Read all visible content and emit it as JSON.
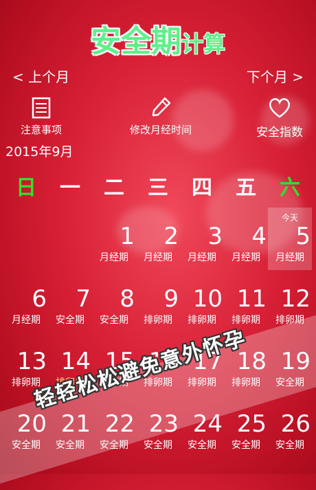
{
  "colors": {
    "title_green": "#5ff08a",
    "sunday": "#30e030",
    "saturday": "#30e030",
    "ovulation_label": "#ffe07a"
  },
  "title": {
    "main": "安全期",
    "sub": "计算"
  },
  "nav": {
    "prev": "< 上个月",
    "next": "下个月 >"
  },
  "tools": [
    {
      "label": "注意事项",
      "icon": "note-icon"
    },
    {
      "label": "修改月经时间",
      "icon": "pencil-icon"
    },
    {
      "label": "安全指数",
      "icon": "heart-icon"
    }
  ],
  "month_label": "2015年9月",
  "weekdays": [
    "日",
    "一",
    "二",
    "三",
    "四",
    "五",
    "六"
  ],
  "today_tag": "今天",
  "weeks": [
    [
      {
        "d": "",
        "l": ""
      },
      {
        "d": "",
        "l": ""
      },
      {
        "d": "1",
        "l": "月经期"
      },
      {
        "d": "2",
        "l": "月经期"
      },
      {
        "d": "3",
        "l": "月经期"
      },
      {
        "d": "4",
        "l": "月经期"
      },
      {
        "d": "5",
        "l": "月经期",
        "today": true
      }
    ],
    [
      {
        "d": "6",
        "l": "月经期"
      },
      {
        "d": "7",
        "l": "安全期"
      },
      {
        "d": "8",
        "l": "安全期"
      },
      {
        "d": "9",
        "l": "排卵期"
      },
      {
        "d": "10",
        "l": "排卵期"
      },
      {
        "d": "11",
        "l": "排卵期"
      },
      {
        "d": "12",
        "l": "排卵期"
      }
    ],
    [
      {
        "d": "13",
        "l": "排卵期"
      },
      {
        "d": "14",
        "l": "排卵日",
        "ovul": true
      },
      {
        "d": "15",
        "l": "排卵期"
      },
      {
        "d": "16",
        "l": "排卵期"
      },
      {
        "d": "17",
        "l": "排卵期"
      },
      {
        "d": "18",
        "l": "排卵期"
      },
      {
        "d": "19",
        "l": "安全期"
      }
    ],
    [
      {
        "d": "20",
        "l": "安全期"
      },
      {
        "d": "21",
        "l": "安全期"
      },
      {
        "d": "22",
        "l": "安全期"
      },
      {
        "d": "23",
        "l": "安全期"
      },
      {
        "d": "24",
        "l": "安全期"
      },
      {
        "d": "25",
        "l": "安全期"
      },
      {
        "d": "26",
        "l": "安全期"
      }
    ]
  ],
  "slogan": "轻轻松松避免意外怀孕"
}
